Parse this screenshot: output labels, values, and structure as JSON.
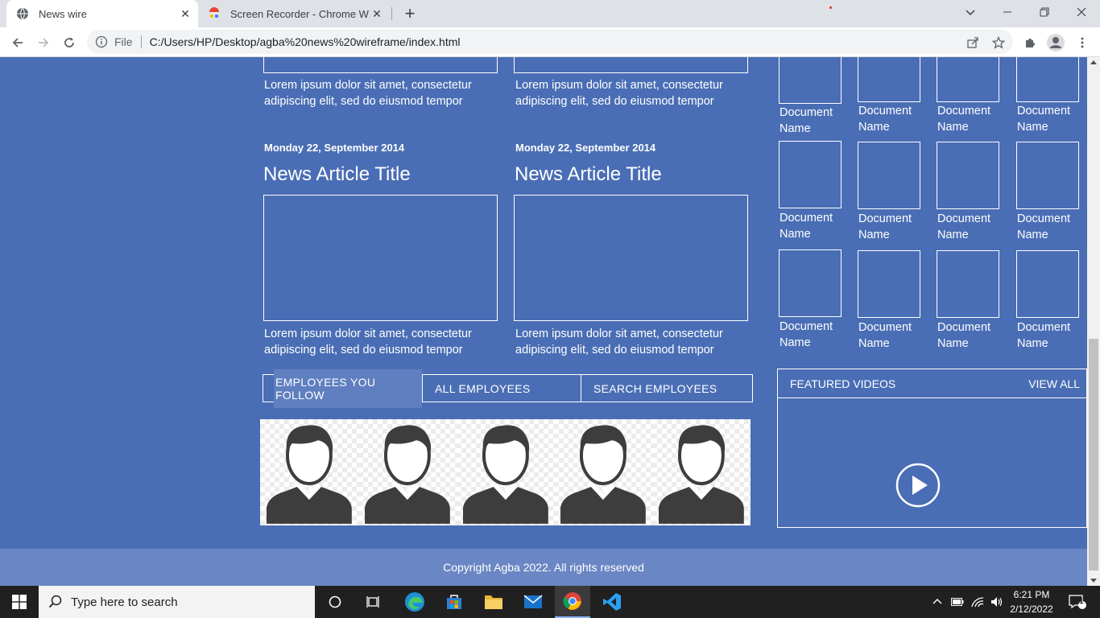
{
  "browser": {
    "tabs": [
      {
        "title": "News wire",
        "active": true
      },
      {
        "title": "Screen Recorder - Chrome Web S",
        "active": false
      }
    ],
    "new_tab_symbol": "+",
    "close_symbol": "✕",
    "url_scheme": "File",
    "url": "C:/Users/HP/Desktop/agba%20news%20wireframe/index.html"
  },
  "articles_top": [
    {
      "excerpt": "Lorem ipsum dolor sit amet, consectetur adipiscing elit, sed do eiusmod tempor"
    },
    {
      "excerpt": "Lorem ipsum dolor sit amet, consectetur adipiscing elit, sed do eiusmod tempor"
    }
  ],
  "articles": [
    {
      "date": "Monday 22, September 2014",
      "title": "News Article Title",
      "excerpt": "Lorem ipsum dolor sit amet, consectetur adipiscing elit, sed do eiusmod tempor"
    },
    {
      "date": "Monday 22, September 2014",
      "title": "News Article Title",
      "excerpt": "Lorem ipsum dolor sit amet, consectetur adipiscing elit, sed do eiusmod tempor"
    }
  ],
  "documents": {
    "label_line1": "Document",
    "label_line2": "Name"
  },
  "employees": {
    "tabs": [
      "EMPLOYEES YOU FOLLOW",
      "ALL EMPLOYEES",
      "SEARCH EMPLOYEES"
    ]
  },
  "videos": {
    "title": "FEATURED VIDEOS",
    "view_all": "VIEW ALL"
  },
  "footer": {
    "copyright": "Copyright Agba 2022. All rights reserved"
  },
  "taskbar": {
    "search_placeholder": "Type here to search",
    "time": "6:21 PM",
    "date": "2/12/2022",
    "notification_count": "1"
  },
  "colors": {
    "page_bg": "#4a6eb5",
    "footer_bg": "#6b86c4"
  }
}
